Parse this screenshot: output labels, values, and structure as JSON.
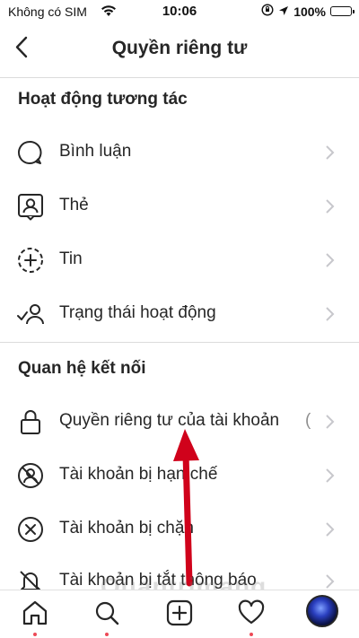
{
  "status_bar": {
    "carrier": "Không có SIM",
    "time": "10:06",
    "battery": "100%"
  },
  "header": {
    "title": "Quyền riêng tư"
  },
  "sections": [
    {
      "title": "Hoạt động tương tác",
      "items": [
        {
          "label": "Bình luận",
          "icon": "comment-icon"
        },
        {
          "label": "Thẻ",
          "icon": "tag-person-icon"
        },
        {
          "label": "Tin",
          "icon": "story-add-icon"
        },
        {
          "label": "Trạng thái hoạt động",
          "icon": "activity-status-icon"
        }
      ]
    },
    {
      "title": "Quan hệ kết nối",
      "items": [
        {
          "label": "Quyền riêng tư của tài khoản",
          "icon": "lock-icon",
          "trailing": "("
        },
        {
          "label": "Tài khoản bị hạn chế",
          "icon": "restricted-icon"
        },
        {
          "label": "Tài khoản bị chặn",
          "icon": "blocked-icon"
        },
        {
          "label": "Tài khoản bị tắt thông báo",
          "icon": "muted-icon"
        }
      ]
    }
  ],
  "tab_bar": [
    "home-icon",
    "search-icon",
    "new-post-icon",
    "activity-heart-icon",
    "profile-avatar"
  ],
  "watermark": "Quantrimang",
  "colors": {
    "text": "#262626",
    "divider": "#dbdbdb",
    "chevron": "#c7c7cc",
    "annotation_arrow": "#d0021b",
    "notification_dot": "#ed4956"
  }
}
